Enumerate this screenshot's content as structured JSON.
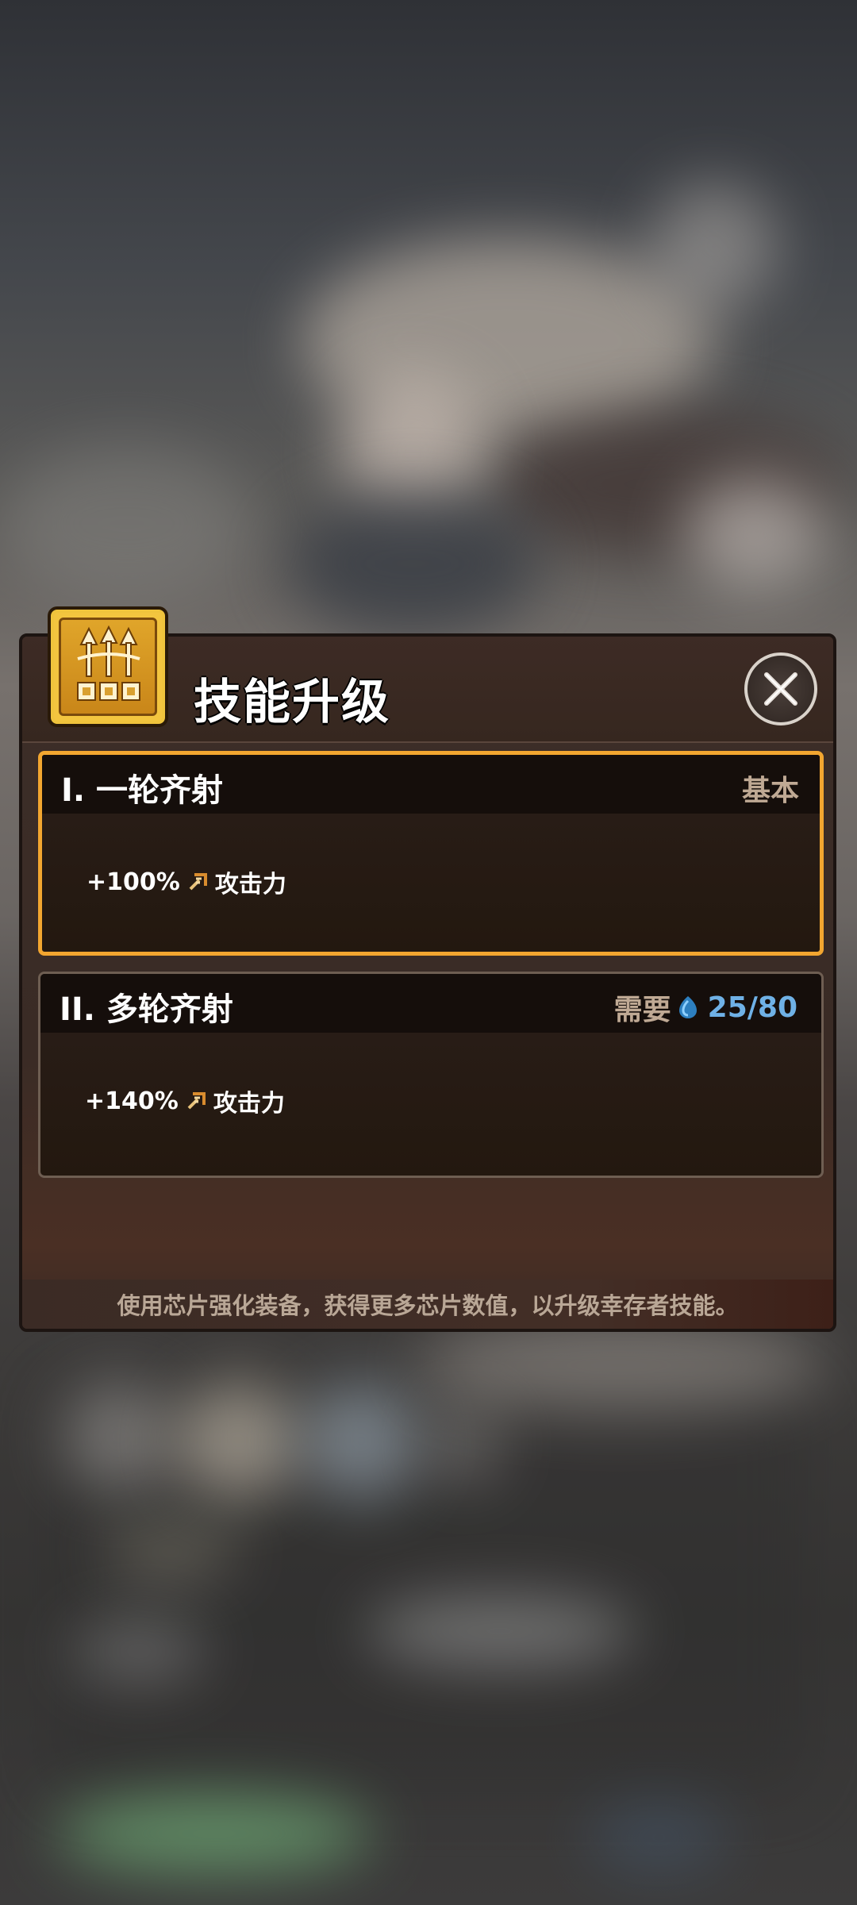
{
  "dialog": {
    "title": "技能升级",
    "close_icon": "close-icon",
    "footer_hint": "使用芯片强化装备，获得更多芯片数值，以升级幸存者技能。"
  },
  "badge": {
    "icon": "triple-arrow-volley-icon"
  },
  "skills": [
    {
      "title": "I. 一轮齐射",
      "tag": "基本",
      "effect_value": "+100%",
      "effect_stat": "攻击力",
      "state": "selected"
    },
    {
      "title": "II. 多轮齐射",
      "requirement_label": "需要",
      "requirement_icon": "chip-icon",
      "requirement_count": "25/80",
      "effect_value": "+140%",
      "effect_stat": "攻击力",
      "state": "locked"
    }
  ],
  "colors": {
    "selected_border": "#f2a630",
    "requirement_count": "#6fb1e6",
    "muted_text": "#bfa994"
  }
}
